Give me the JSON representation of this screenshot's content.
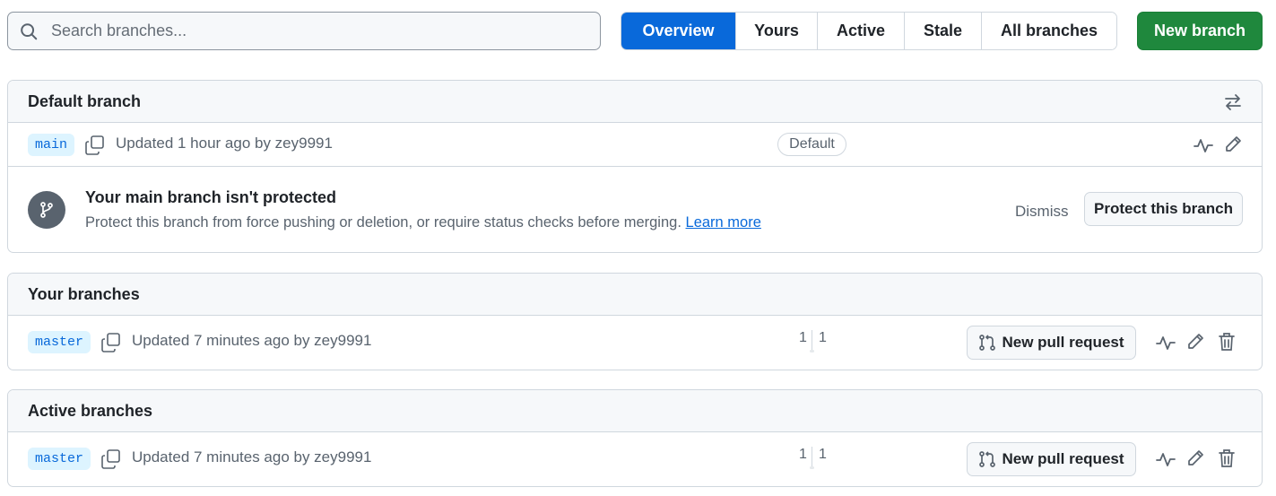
{
  "search": {
    "placeholder": "Search branches..."
  },
  "tabs": [
    {
      "label": "Overview",
      "active": true
    },
    {
      "label": "Yours"
    },
    {
      "label": "Active"
    },
    {
      "label": "Stale"
    },
    {
      "label": "All branches"
    }
  ],
  "new_branch_label": "New branch",
  "default_section": {
    "title": "Default branch",
    "branch": {
      "name": "main",
      "updated": "Updated 1 hour ago by zey9991",
      "badge": "Default"
    },
    "protect": {
      "title": "Your main branch isn't protected",
      "description": "Protect this branch from force pushing or deletion, or require status checks before merging.",
      "learn_more": "Learn more",
      "dismiss": "Dismiss",
      "button": "Protect this branch"
    }
  },
  "your_section": {
    "title": "Your branches",
    "branch": {
      "name": "master",
      "updated": "Updated 7 minutes ago by zey9991",
      "ahead": "1",
      "behind": "1",
      "pr_label": "New pull request"
    }
  },
  "active_section": {
    "title": "Active branches",
    "branch": {
      "name": "master",
      "updated": "Updated 7 minutes ago by zey9991",
      "ahead": "1",
      "behind": "1",
      "pr_label": "New pull request"
    }
  },
  "colors": {
    "accent": "#0969da",
    "primary_button": "#1f883d",
    "muted": "#59636e",
    "border": "#d0d7de"
  },
  "icons": [
    "search-icon",
    "switch-arrows-icon",
    "copy-icon",
    "activity-icon",
    "pencil-icon",
    "git-branch-icon",
    "git-pull-request-icon",
    "trash-icon"
  ]
}
